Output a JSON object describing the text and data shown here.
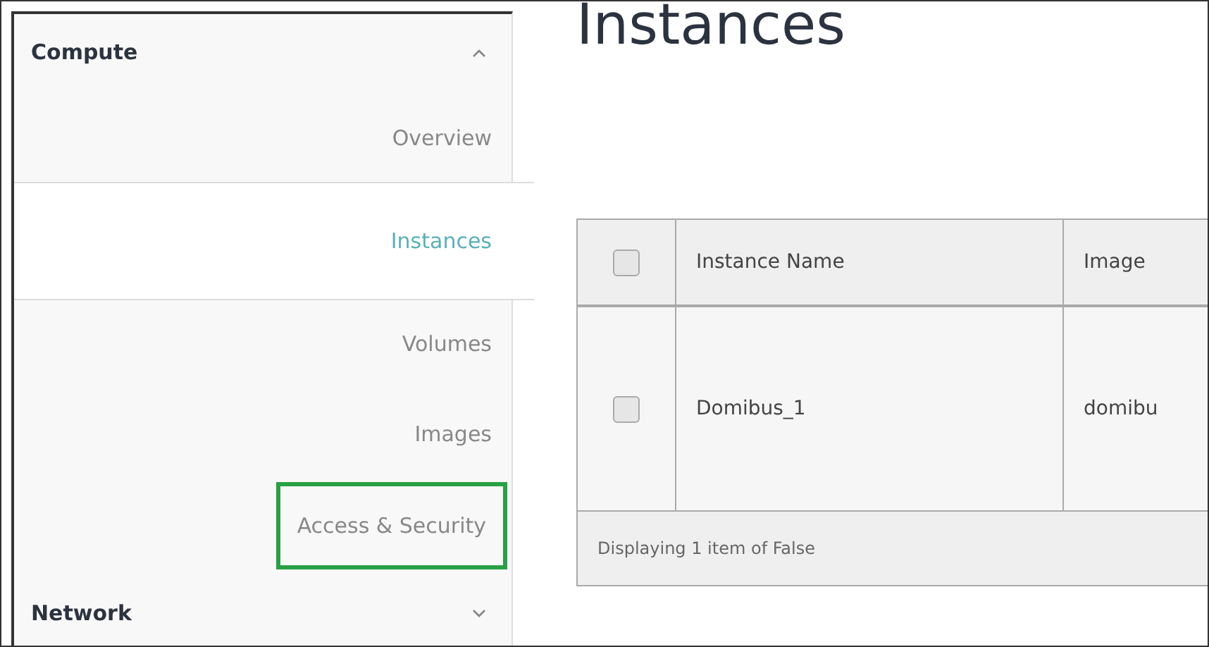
{
  "sidebar": {
    "groups": [
      {
        "label": "Compute",
        "expanded": true,
        "items": [
          {
            "label": "Overview",
            "selected": false,
            "highlighted": false
          },
          {
            "label": "Instances",
            "selected": true,
            "highlighted": false
          },
          {
            "label": "Volumes",
            "selected": false,
            "highlighted": false
          },
          {
            "label": "Images",
            "selected": false,
            "highlighted": false
          },
          {
            "label": "Access & Security",
            "selected": false,
            "highlighted": true
          }
        ]
      },
      {
        "label": "Network",
        "expanded": false
      }
    ]
  },
  "page_title": "Instances",
  "table": {
    "columns": [
      "Instance Name",
      "Image"
    ],
    "header_checked": false,
    "rows": [
      {
        "checked": false,
        "cells": [
          "Domibus_1",
          "domibu"
        ]
      }
    ],
    "footer": "Displaying 1 item of False"
  }
}
